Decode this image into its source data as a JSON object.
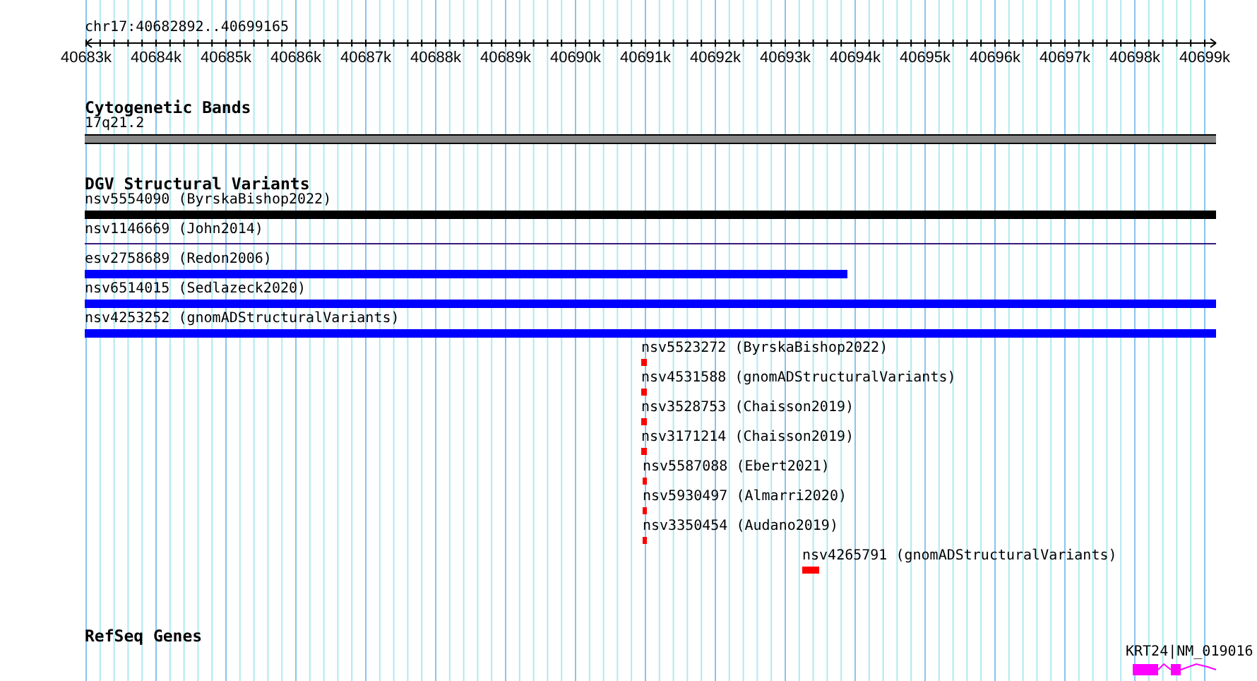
{
  "ruler": {
    "position": "chr17:40682892..40699165",
    "ticks": [
      "40683k",
      "40684k",
      "40685k",
      "40686k",
      "40687k",
      "40688k",
      "40689k",
      "40690k",
      "40691k",
      "40692k",
      "40693k",
      "40694k",
      "40695k",
      "40696k",
      "40697k",
      "40698k",
      "40699k"
    ]
  },
  "tracks": [
    {
      "kind": "ideogram",
      "title": "Cytogenetic Bands",
      "band": "17q21.2"
    },
    {
      "kind": "variants",
      "title": "DGV Structural Variants",
      "items": [
        {
          "label": "nsv5554090 (ByrskaBishop2022)",
          "kind": "bar",
          "color": "#000000"
        },
        {
          "label": "nsv1146669 (John2014)",
          "kind": "line",
          "color": "#3a1a7a"
        },
        {
          "label": "esv2758689 (Redon2006)",
          "kind": "bar",
          "color": "#0000ff"
        },
        {
          "label": "nsv6514015 (Sedlazeck2020)",
          "kind": "bar",
          "color": "#0000ff"
        },
        {
          "label": "nsv4253252 (gnomADStructuralVariants)",
          "kind": "bar",
          "color": "#0000ff"
        },
        {
          "label": "nsv5523272 (ByrskaBishop2022)",
          "kind": "bar",
          "color": "#ff0000"
        },
        {
          "label": "nsv4531588 (gnomADStructuralVariants)",
          "kind": "bar",
          "color": "#ff0000"
        },
        {
          "label": "nsv3528753 (Chaisson2019)",
          "kind": "bar",
          "color": "#ff0000"
        },
        {
          "label": "nsv3171214 (Chaisson2019)",
          "kind": "bar",
          "color": "#ff0000"
        },
        {
          "label": "nsv5587088 (Ebert2021)",
          "kind": "bar",
          "color": "#ff0000"
        },
        {
          "label": "nsv5930497 (Almarri2020)",
          "kind": "bar",
          "color": "#ff0000"
        },
        {
          "label": "nsv3350454 (Audano2019)",
          "kind": "bar",
          "color": "#ff0000"
        },
        {
          "label": "nsv4265791 (gnomADStructuralVariants)",
          "kind": "bar",
          "color": "#ff0000"
        }
      ]
    },
    {
      "kind": "genes",
      "title": "RefSeq Genes",
      "items": [
        {
          "label": "KRT24|NM_019016",
          "color": "#ff00ff"
        }
      ]
    }
  ]
}
